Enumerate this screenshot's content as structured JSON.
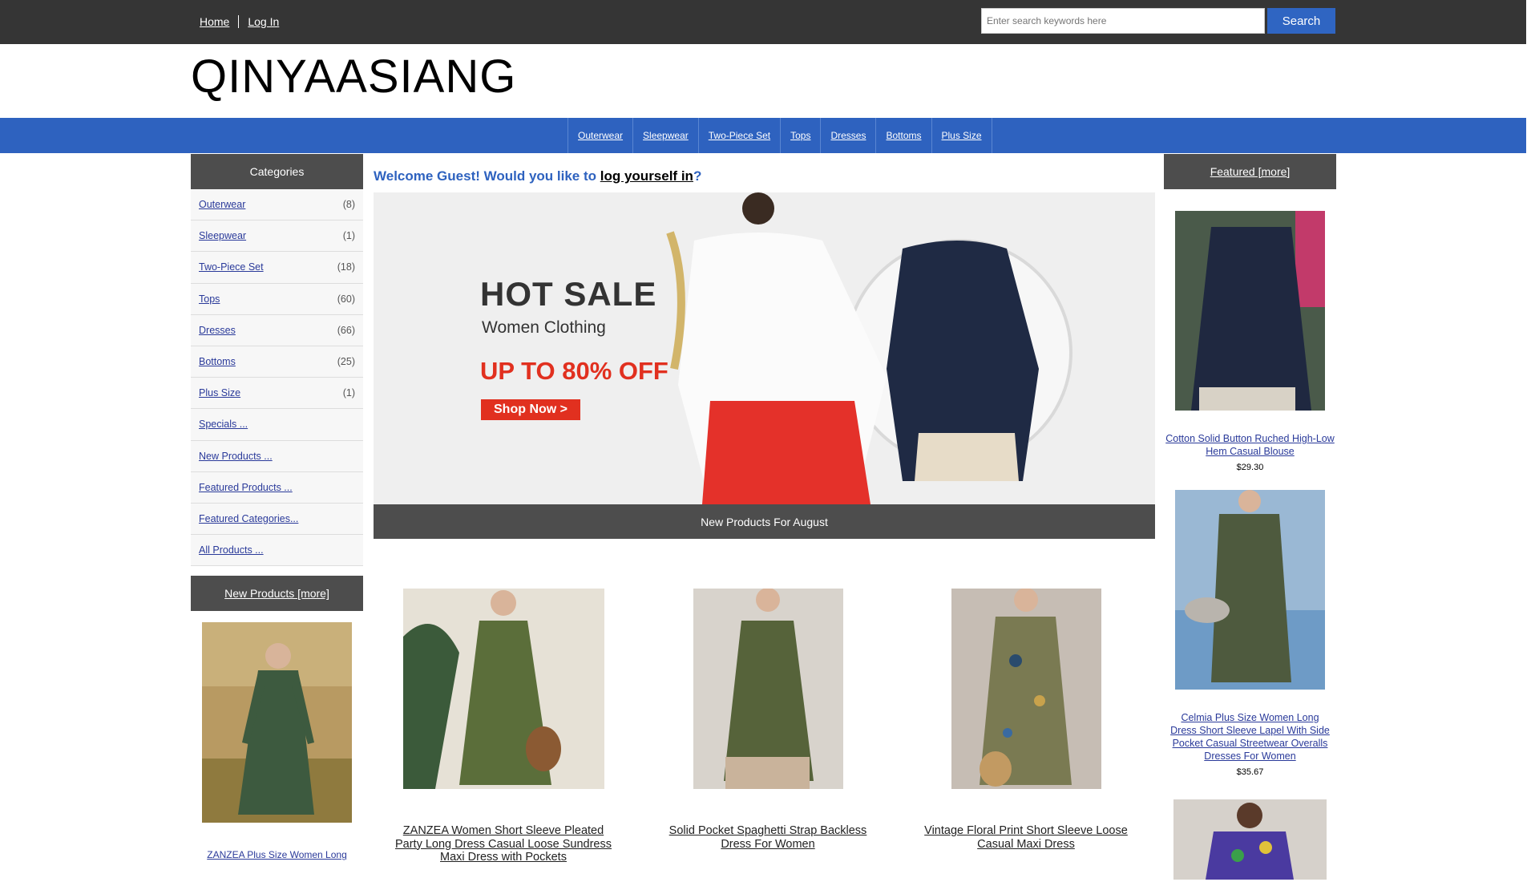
{
  "header": {
    "links": [
      "Home",
      "Log In"
    ],
    "search_placeholder": "Enter search keywords here",
    "search_button": "Search",
    "logo": "QINYAASIANG"
  },
  "nav": [
    "Outerwear",
    "Sleepwear",
    "Two-Piece Set",
    "Tops",
    "Dresses",
    "Bottoms",
    "Plus Size"
  ],
  "categories": {
    "title": "Categories",
    "items": [
      {
        "label": "Outerwear",
        "count": "(8)"
      },
      {
        "label": "Sleepwear",
        "count": "(1)"
      },
      {
        "label": "Two-Piece Set",
        "count": "(18)"
      },
      {
        "label": "Tops",
        "count": "(60)"
      },
      {
        "label": "Dresses",
        "count": "(66)"
      },
      {
        "label": "Bottoms",
        "count": "(25)"
      },
      {
        "label": "Plus Size",
        "count": "(1)"
      },
      {
        "label": "Specials ...",
        "count": ""
      },
      {
        "label": "New Products ...",
        "count": ""
      },
      {
        "label": "Featured Products ...",
        "count": ""
      },
      {
        "label": "Featured Categories...",
        "count": ""
      },
      {
        "label": "All Products ...",
        "count": ""
      }
    ]
  },
  "new_products_box": {
    "title": "New Products  [more]",
    "item_title": "ZANZEA Plus Size Women Long"
  },
  "main": {
    "welcome_prefix": "Welcome Guest! Would you like to ",
    "welcome_link": "log yourself in",
    "welcome_suffix": "?",
    "banner": {
      "headline": "HOT SALE",
      "sub": "Women Clothing",
      "offer": "UP TO 80% OFF",
      "cta": "Shop Now >"
    },
    "section_title": "New Products For August",
    "products": [
      {
        "title": "ZANZEA Women Short Sleeve Pleated Party Long Dress Casual Loose Sundress Maxi Dress with Pockets"
      },
      {
        "title": "Solid Pocket Spaghetti Strap Backless Dress For Women"
      },
      {
        "title": "Vintage Floral Print Short Sleeve Loose Casual Maxi Dress"
      }
    ]
  },
  "featured": {
    "title": "Featured  [more]",
    "items": [
      {
        "title": "Cotton Solid Button Ruched High-Low Hem Casual Blouse",
        "price": "$29.30"
      },
      {
        "title": "Celmia Plus Size Women Long Dress Short Sleeve Lapel With Side Pocket Casual Streetwear Overalls Dresses For Women",
        "price": "$35.67"
      }
    ]
  },
  "colors": {
    "topbar": "#353535",
    "navbar": "#2e62bf",
    "boxhead": "#4d4d4d",
    "accent_red": "#e1301f"
  }
}
